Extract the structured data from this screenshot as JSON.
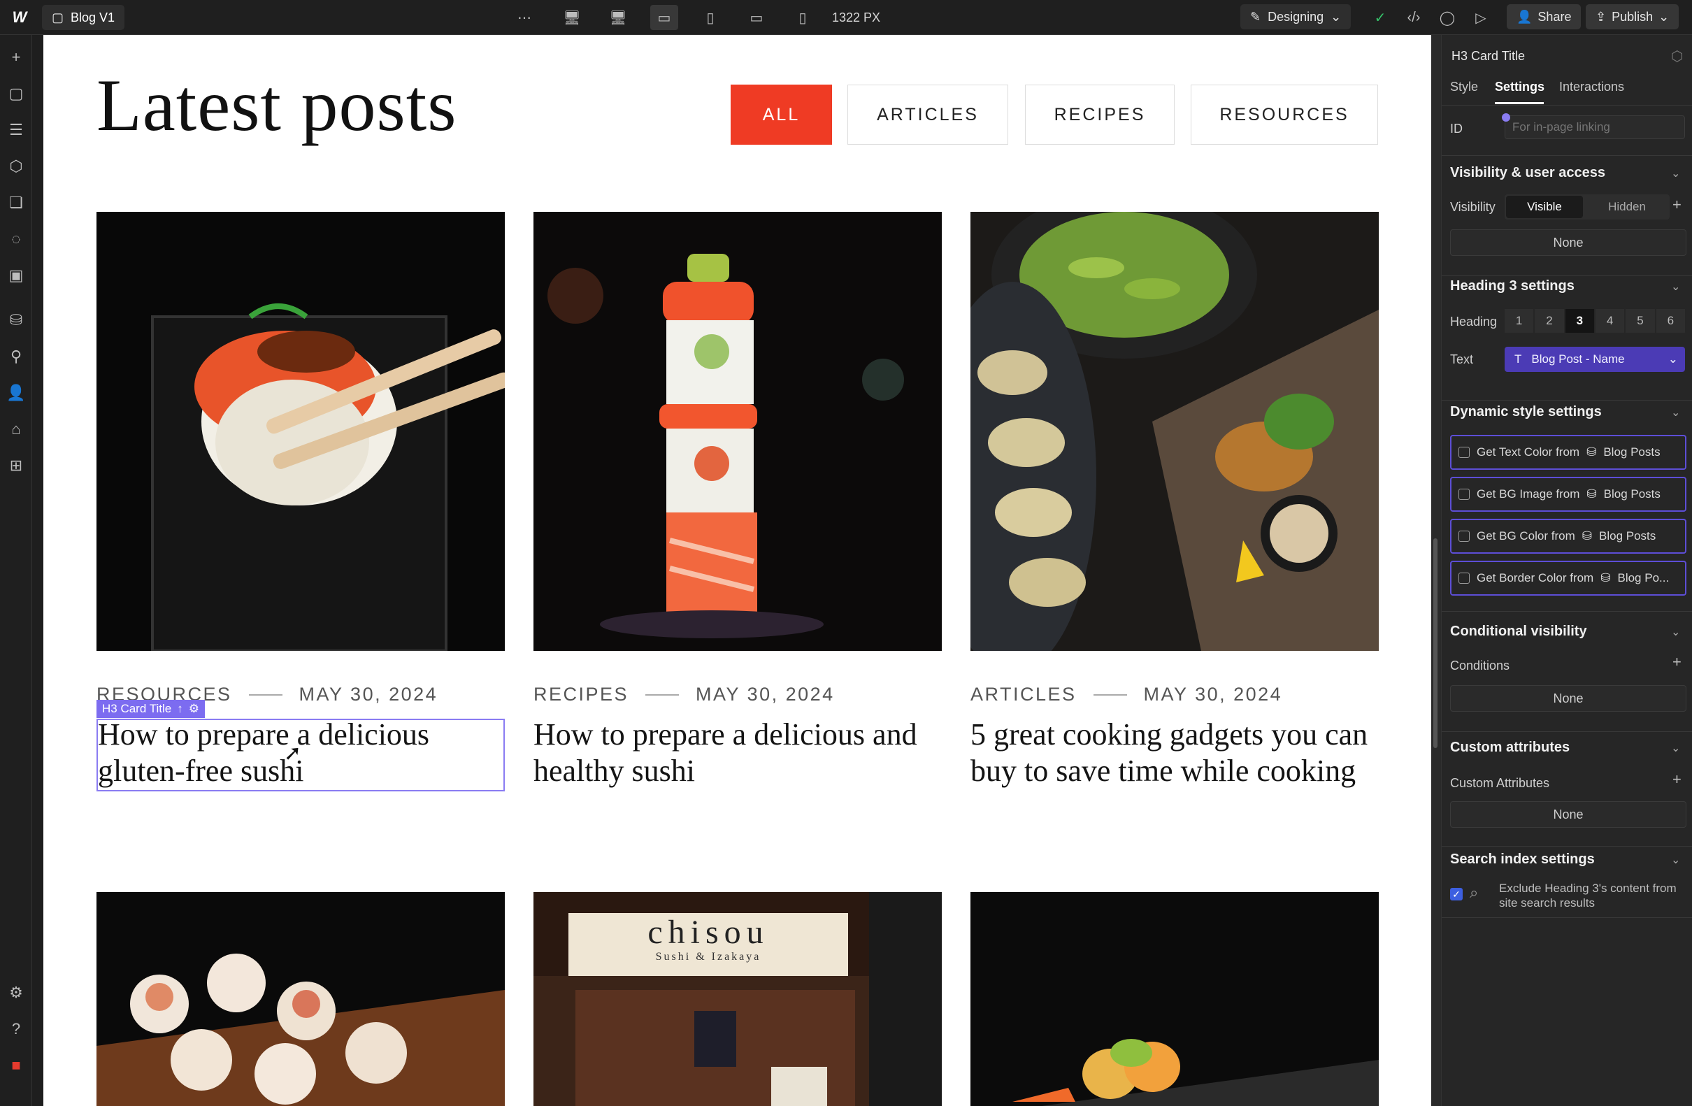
{
  "topbar": {
    "page_name": "Blog V1",
    "canvas_width": "1322 PX",
    "mode": "Designing",
    "share": "Share",
    "publish": "Publish"
  },
  "page": {
    "title": "Latest posts",
    "filters": [
      "ALL",
      "ARTICLES",
      "RECIPES",
      "RESOURCES"
    ],
    "cards": [
      {
        "category": "RESOURCES",
        "date": "MAY 30, 2024",
        "title": "How to prepare a delicious gluten-free sushi"
      },
      {
        "category": "RECIPES",
        "date": "MAY 30, 2024",
        "title": "How to prepare a delicious and healthy sushi"
      },
      {
        "category": "ARTICLES",
        "date": "MAY 30, 2024",
        "title": "5 great cooking gadgets you can buy to save time while cooking"
      }
    ],
    "restaurant_sign": "chisou",
    "restaurant_sub": "Sushi & Izakaya",
    "selection_tag": "H3 Card Title"
  },
  "panel": {
    "element": "H3  Card Title",
    "tabs": [
      "Style",
      "Settings",
      "Interactions"
    ],
    "id_label": "ID",
    "id_placeholder": "For in-page linking",
    "visibility_section": "Visibility & user access",
    "visibility_label": "Visibility",
    "visible": "Visible",
    "hidden": "Hidden",
    "none": "None",
    "heading_section": "Heading 3 settings",
    "heading_label": "Heading",
    "heading_levels": [
      "1",
      "2",
      "3",
      "4",
      "5",
      "6"
    ],
    "text_label": "Text",
    "text_binding": "Blog Post - Name",
    "dynamic_section": "Dynamic style settings",
    "dynamic_rows": [
      {
        "label": "Get Text Color from",
        "source": "Blog Posts"
      },
      {
        "label": "Get BG Image from",
        "source": "Blog Posts"
      },
      {
        "label": "Get BG Color from",
        "source": "Blog Posts"
      },
      {
        "label": "Get Border Color from",
        "source": "Blog Po..."
      }
    ],
    "conditional_section": "Conditional visibility",
    "conditions_label": "Conditions",
    "custom_section": "Custom attributes",
    "custom_label": "Custom Attributes",
    "search_section": "Search index settings",
    "search_option": "Exclude Heading 3's content from site search results"
  },
  "colors": {
    "accent": "#ef3b24",
    "selection": "#7c6cf0",
    "binding": "#4b3bb5"
  }
}
